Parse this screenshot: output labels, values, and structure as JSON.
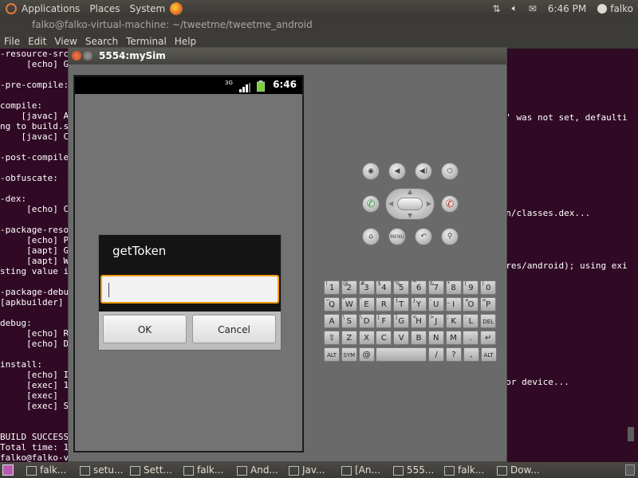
{
  "topbar": {
    "menu": [
      "Applications",
      "Places",
      "System"
    ],
    "time": "6:46 PM",
    "user": "falko"
  },
  "terminal": {
    "title": "falko@falko-virtual-machine: ~/tweetme/tweetme_android",
    "menu": [
      "File",
      "Edit",
      "View",
      "Search",
      "Terminal",
      "Help"
    ],
    "left_lines": [
      "-resource-src:",
      "     [echo] G",
      "",
      "-pre-compile:",
      "",
      "compile:",
      "    [javac] A",
      "ng to build.s",
      "    [javac] C",
      "",
      "-post-compile",
      "",
      "-obfuscate:",
      "",
      "-dex:",
      "     [echo] C",
      "",
      "-package-reso",
      "     [echo] P",
      "     [aapt] G",
      "     [aapt] W",
      "sting value i",
      "",
      "-package-debu",
      "[apkbuilder] ",
      "",
      "debug:",
      "     [echo] R",
      "     [echo] D",
      "",
      "install:",
      "     [echo] I",
      "     [exec] 1",
      "     [exec] ",
      "     [exec] S",
      "",
      "",
      "BUILD SUCCESS",
      "Total time: 1",
      "falko@falko-v"
    ],
    "right_lines": {
      "r1": "me' was not set, defaulti",
      "r2": "bin/classes.dex...",
      "r3": "t/res/android); using exi",
      "r4": "r or device..."
    }
  },
  "emulator": {
    "title": "5554:mySim",
    "status_time": "6:46",
    "signal": "3G",
    "dialog": {
      "title": "getToken",
      "input_value": "",
      "ok_label": "OK",
      "cancel_label": "Cancel"
    },
    "controls": {
      "menu_label": "MENU"
    },
    "keyboard": {
      "row1": [
        {
          "k": "1",
          "s": "!"
        },
        {
          "k": "2",
          "s": "@"
        },
        {
          "k": "3",
          "s": "#"
        },
        {
          "k": "4",
          "s": "$"
        },
        {
          "k": "5",
          "s": "%"
        },
        {
          "k": "6",
          "s": "^"
        },
        {
          "k": "7",
          "s": "&"
        },
        {
          "k": "8",
          "s": "*"
        },
        {
          "k": "9",
          "s": "("
        },
        {
          "k": "0",
          "s": ")"
        }
      ],
      "row2": [
        {
          "k": "Q",
          "s": "~"
        },
        {
          "k": "W",
          "s": "\""
        },
        {
          "k": "E",
          "s": "'"
        },
        {
          "k": "R",
          "s": "`"
        },
        {
          "k": "T",
          "s": "{"
        },
        {
          "k": "Y",
          "s": "}"
        },
        {
          "k": "U",
          "s": "-"
        },
        {
          "k": "I",
          "s": "_"
        },
        {
          "k": "O",
          "s": "+"
        },
        {
          "k": "P",
          "s": "="
        }
      ],
      "row3": [
        {
          "k": "A",
          "s": ""
        },
        {
          "k": "S",
          "s": "\\"
        },
        {
          "k": "D",
          "s": "\\"
        },
        {
          "k": "F",
          "s": "["
        },
        {
          "k": "G",
          "s": "]"
        },
        {
          "k": "H",
          "s": "<"
        },
        {
          "k": "J",
          "s": ">"
        },
        {
          "k": "K",
          "s": ";"
        },
        {
          "k": "L",
          "s": ":"
        },
        {
          "k": "DEL",
          "s": ""
        }
      ],
      "row4": [
        {
          "k": "⇧",
          "s": ""
        },
        {
          "k": "Z",
          "s": ""
        },
        {
          "k": "X",
          "s": ""
        },
        {
          "k": "C",
          "s": ""
        },
        {
          "k": "V",
          "s": ""
        },
        {
          "k": "B",
          "s": ""
        },
        {
          "k": "N",
          "s": ""
        },
        {
          "k": "M",
          "s": ""
        },
        {
          "k": ".",
          "s": ""
        },
        {
          "k": "↵",
          "s": ""
        }
      ],
      "row5": [
        "ALT",
        "SYM",
        "@",
        "",
        "/",
        "?",
        ",",
        "ALT"
      ]
    }
  },
  "taskbar": {
    "items": [
      "falk...",
      "setu...",
      "Sett...",
      "falk...",
      "And...",
      "Jav...",
      "[An...",
      "555...",
      "falk...",
      "Dow..."
    ]
  }
}
